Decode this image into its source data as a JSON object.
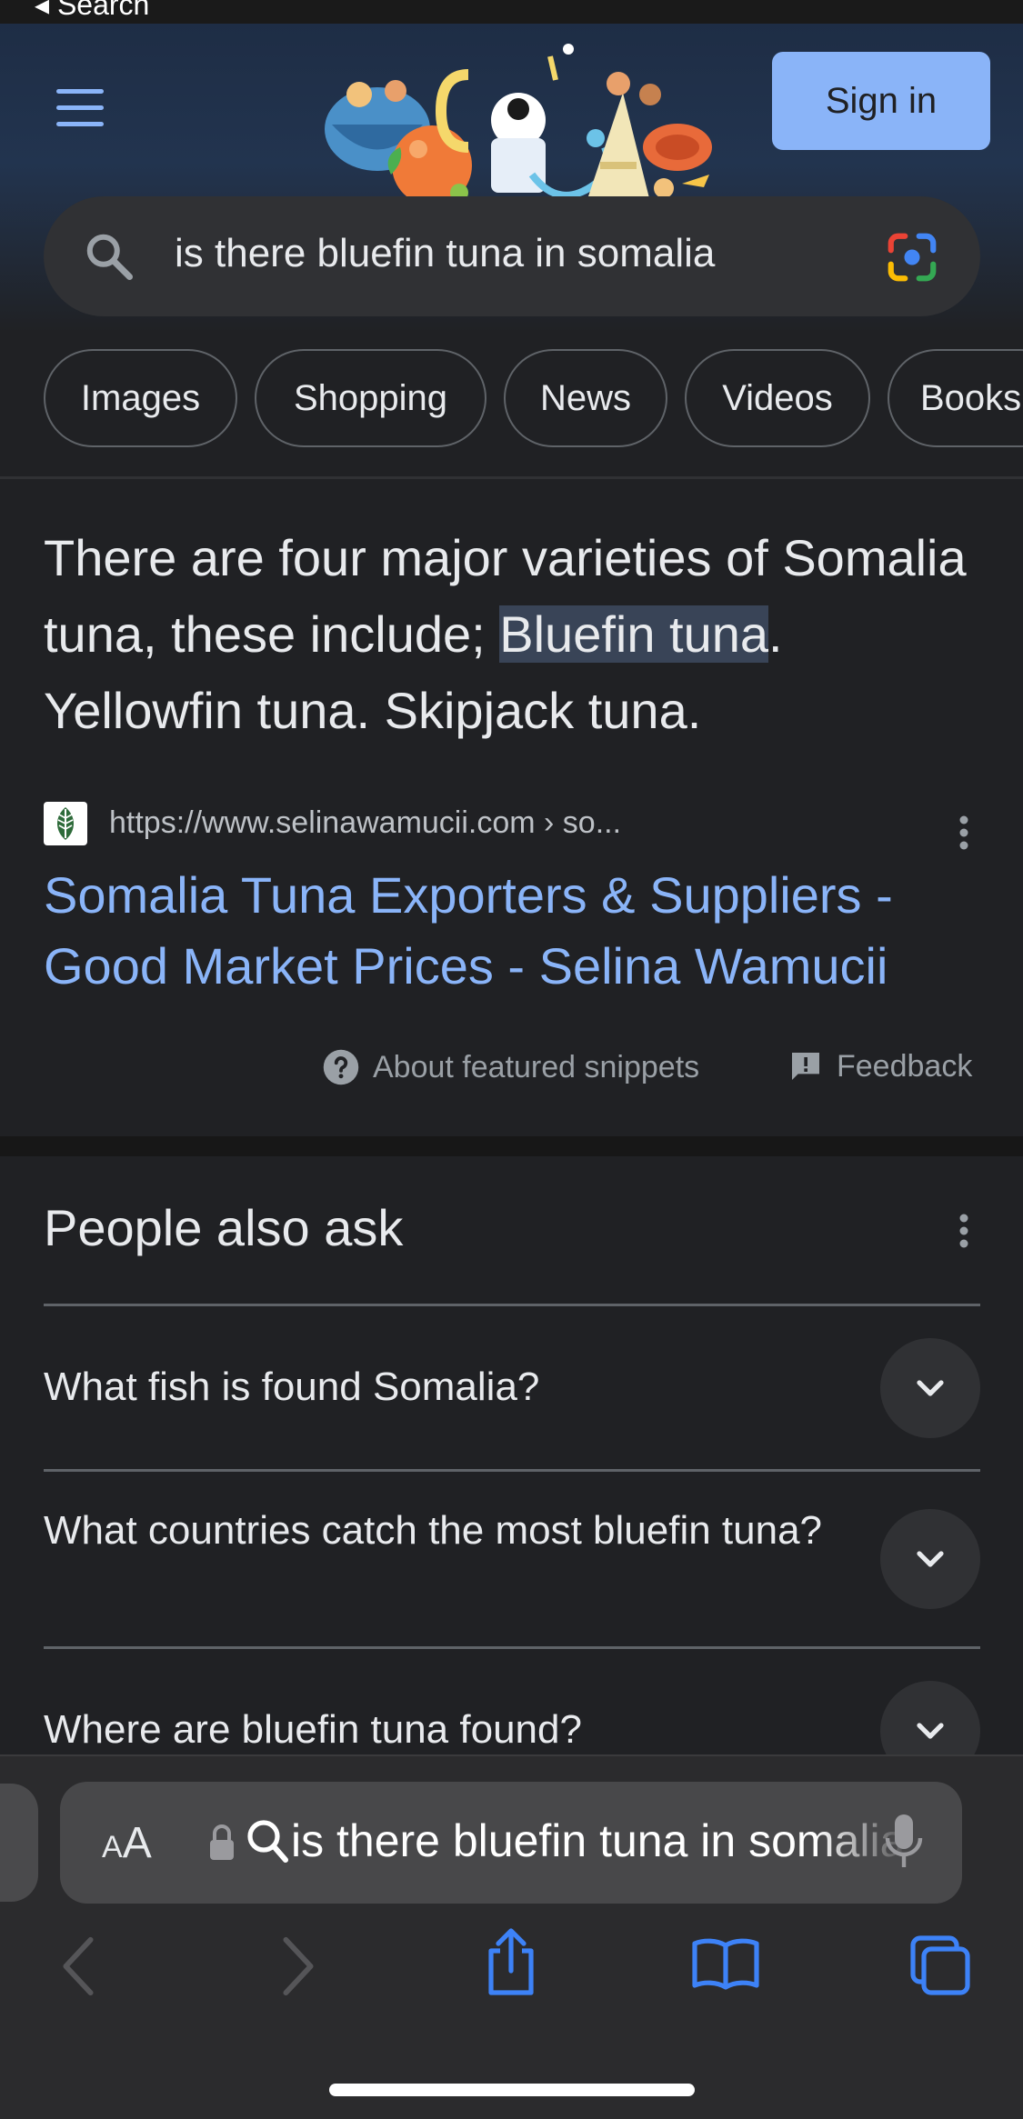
{
  "status_bar": {
    "back_label": "◂ Search"
  },
  "header": {
    "sign_in_label": "Sign in"
  },
  "search": {
    "query": "is there bluefin tuna in somalia"
  },
  "chips": [
    "Images",
    "Shopping",
    "News",
    "Videos",
    "Books"
  ],
  "featured_snippet": {
    "text_before": "There are four major varieties of Somalia tuna, these include; ",
    "highlight": "Bluefin tuna",
    "text_after": ". Yellowfin tuna. Skipjack tuna.",
    "source_url": "https://www.selinawamucii.com › so...",
    "title": "Somalia Tuna Exporters & Suppliers - Good Market Prices - Selina Wamucii",
    "about_label": "About featured snippets",
    "feedback_label": "Feedback"
  },
  "people_also_ask": {
    "title": "People also ask",
    "questions": [
      "What fish is found Somalia?",
      "What countries catch the most bluefin tuna?",
      "Where are bluefin tuna found?"
    ]
  },
  "browser": {
    "text_size_label": "AA",
    "address_text": "is there bluefin tuna in somalia"
  },
  "colors": {
    "background": "#202124",
    "accent": "#8ab4f8",
    "header_gradient_top": "#1e2d45",
    "safari_toolbar": "#2b2b2d",
    "safari_accent": "#3d82f7"
  },
  "icons": [
    "menu-icon",
    "search-icon",
    "google-lens-icon",
    "more-vert-icon",
    "help-icon",
    "feedback-icon",
    "chevron-down-icon",
    "lock-icon",
    "magnifier-icon",
    "microphone-icon",
    "back-icon",
    "forward-icon",
    "share-icon",
    "bookmarks-icon",
    "tabs-icon"
  ]
}
